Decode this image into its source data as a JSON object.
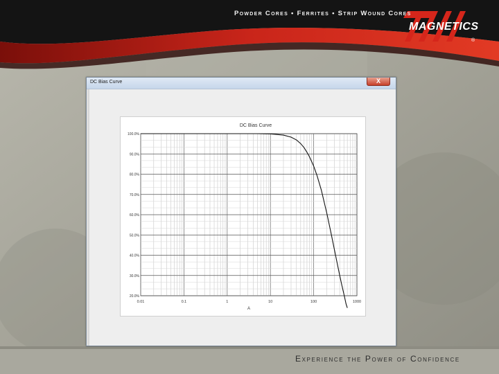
{
  "header": {
    "tagline": "Powder Cores • Ferrites • Strip Wound Cores",
    "logo": "MAGNETICS",
    "registered": "®"
  },
  "footer": {
    "tagline": "Experience the Power of Confidence"
  },
  "window": {
    "title": "DC Bias Curve",
    "close_label": "X"
  },
  "colors": {
    "brand_red": "#c0261a",
    "curve": "#111111"
  },
  "chart_data": {
    "type": "line",
    "title": "DC Bias Curve",
    "xlabel": "A",
    "ylabel": "",
    "x_scale": "log",
    "xlim": [
      0.01,
      1000
    ],
    "ylim": [
      0,
      100
    ],
    "x_ticks": [
      "0.01",
      "0.1",
      "1",
      "10",
      "100",
      "1000"
    ],
    "y_ticks": [
      "100.0%",
      "90.0%",
      "80.0%",
      "70.0%",
      "60.0%",
      "50.0%",
      "40.0%",
      "30.0%",
      "20.0%"
    ],
    "grid": true,
    "series": [
      {
        "x": [
          0.01,
          1,
          5,
          10,
          20,
          30,
          40,
          50,
          60,
          70,
          80,
          100,
          120,
          150,
          200,
          250,
          300,
          350,
          400,
          450,
          500,
          560,
          600
        ],
        "values": [
          100,
          100,
          100,
          99.9,
          99.3,
          98.3,
          96.9,
          95.1,
          93.1,
          90.8,
          88.6,
          84.0,
          79.2,
          72.2,
          61.0,
          51.3,
          43.0,
          36.0,
          30.0,
          25.0,
          20.8,
          16.0,
          14.0
        ]
      }
    ]
  }
}
